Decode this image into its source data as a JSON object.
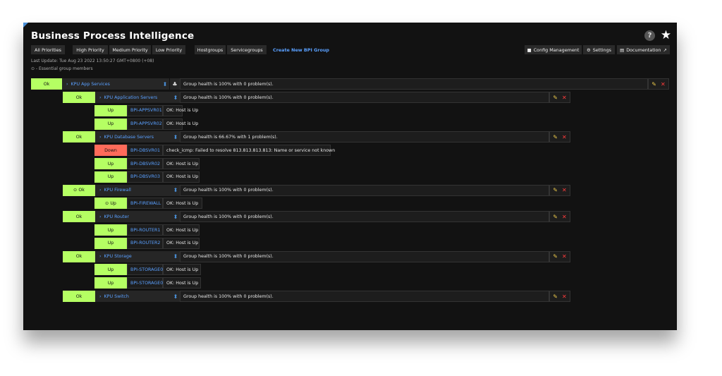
{
  "app": {
    "title": "Business Process Intelligence",
    "help_icon": "?",
    "star_icon": "★"
  },
  "tabs": {
    "all_priorities": "All Priorities",
    "high_priority": "High Priority",
    "medium_priority": "Medium Priority",
    "low_priority": "Low Priority",
    "hostgroups": "Hostgroups",
    "servicegroups": "Servicegroups",
    "create_new": "Create New BPI Group",
    "config_management": "Config Management",
    "settings": "Settings",
    "documentation": "Documentation"
  },
  "meta": {
    "last_update": "Last Update: Tue Aug 23 2022 13:50:27 GMT+0800 (+08)",
    "essential_note": "⊙ - Essential group members"
  },
  "root_group": {
    "status": "Ok",
    "name": "KPU App Services",
    "message": "Group health is 100% with 0 problem(s)."
  },
  "groups": [
    {
      "status": "Ok",
      "name": "KPU Application Servers",
      "message": "Group health is 100% with 0 problem(s).",
      "hosts": [
        {
          "status": "Up",
          "name": "BPI-APPSVR01",
          "message": "OK: Host is Up"
        },
        {
          "status": "Up",
          "name": "BPI-APPSVR02",
          "message": "OK: Host is Up"
        }
      ]
    },
    {
      "status": "Ok",
      "name": "KPU Database Servers",
      "message": "Group health is 66.67% with 1 problem(s).",
      "hosts": [
        {
          "status": "Down",
          "name": "BPI-DBSVR01",
          "message": "check_icmp: Failed to resolve 813.813.813.813: Name or service not known"
        },
        {
          "status": "Up",
          "name": "BPI-DBSVR02",
          "message": "OK: Host is Up"
        },
        {
          "status": "Up",
          "name": "BPI-DBSVR03",
          "message": "OK: Host is Up"
        }
      ]
    },
    {
      "status": "⊙ Ok",
      "name": "KPU Firewall",
      "message": "Group health is 100% with 0 problem(s).",
      "hosts": [
        {
          "status": "⊙ Up",
          "name": "BPI-FIREWALL",
          "message": "OK: Host is Up"
        }
      ]
    },
    {
      "status": "Ok",
      "name": "KPU Router",
      "message": "Group health is 100% with 0 problem(s).",
      "hosts": [
        {
          "status": "Up",
          "name": "BPI-ROUTER1",
          "message": "OK: Host is Up"
        },
        {
          "status": "Up",
          "name": "BPI-ROUTER2",
          "message": "OK: Host is Up"
        }
      ]
    },
    {
      "status": "Ok",
      "name": "KPU Storage",
      "message": "Group health is 100% with 0 problem(s).",
      "hosts": [
        {
          "status": "Up",
          "name": "BPI-STORAGE01",
          "message": "OK: Host is Up"
        },
        {
          "status": "Up",
          "name": "BPI-STORAGE02",
          "message": "OK: Host is Up"
        }
      ]
    },
    {
      "status": "Ok",
      "name": "KPU Switch",
      "message": "Group health is 100% with 0 problem(s).",
      "hosts": []
    }
  ],
  "colors": {
    "ok": "#b5ff63",
    "down": "#ff6b5a",
    "link": "#5aa0ff",
    "background": "#121212"
  }
}
